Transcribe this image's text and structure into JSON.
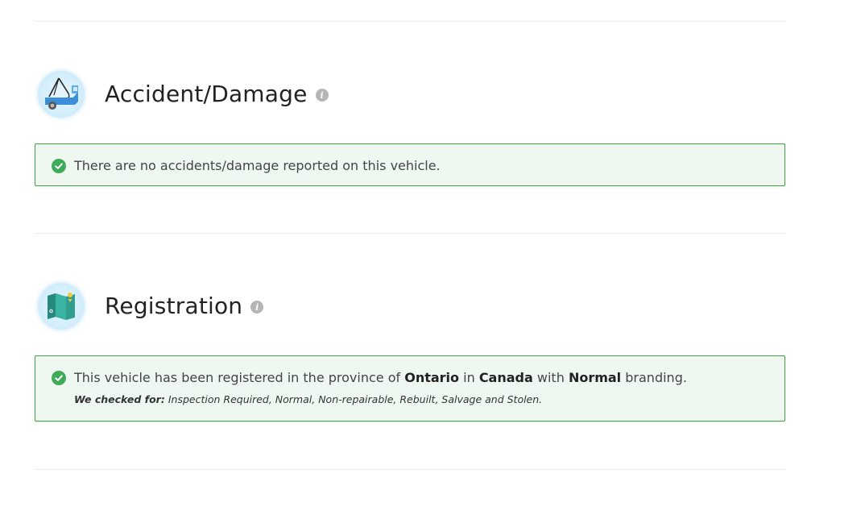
{
  "accident": {
    "title": "Accident/Damage",
    "info_icon": "i",
    "icon_name": "tow-truck-icon",
    "message": "There are no accidents/damage reported on this vehicle."
  },
  "registration": {
    "title": "Registration",
    "info_icon": "i",
    "icon_name": "map-icon",
    "message_prefix": "This vehicle has been registered in the province of",
    "province": "Ontario",
    "in_word": "in",
    "country": "Canada",
    "with_word": "with",
    "branding": "Normal",
    "message_suffix": "branding.",
    "checked_label": "We checked for:",
    "checked_list": "Inspection Required, Normal, Non-repairable, Rebuilt, Salvage and Stolen."
  },
  "colors": {
    "success_border": "#43a047",
    "success_bg": "#eff8f0",
    "check": "#3faa58"
  }
}
